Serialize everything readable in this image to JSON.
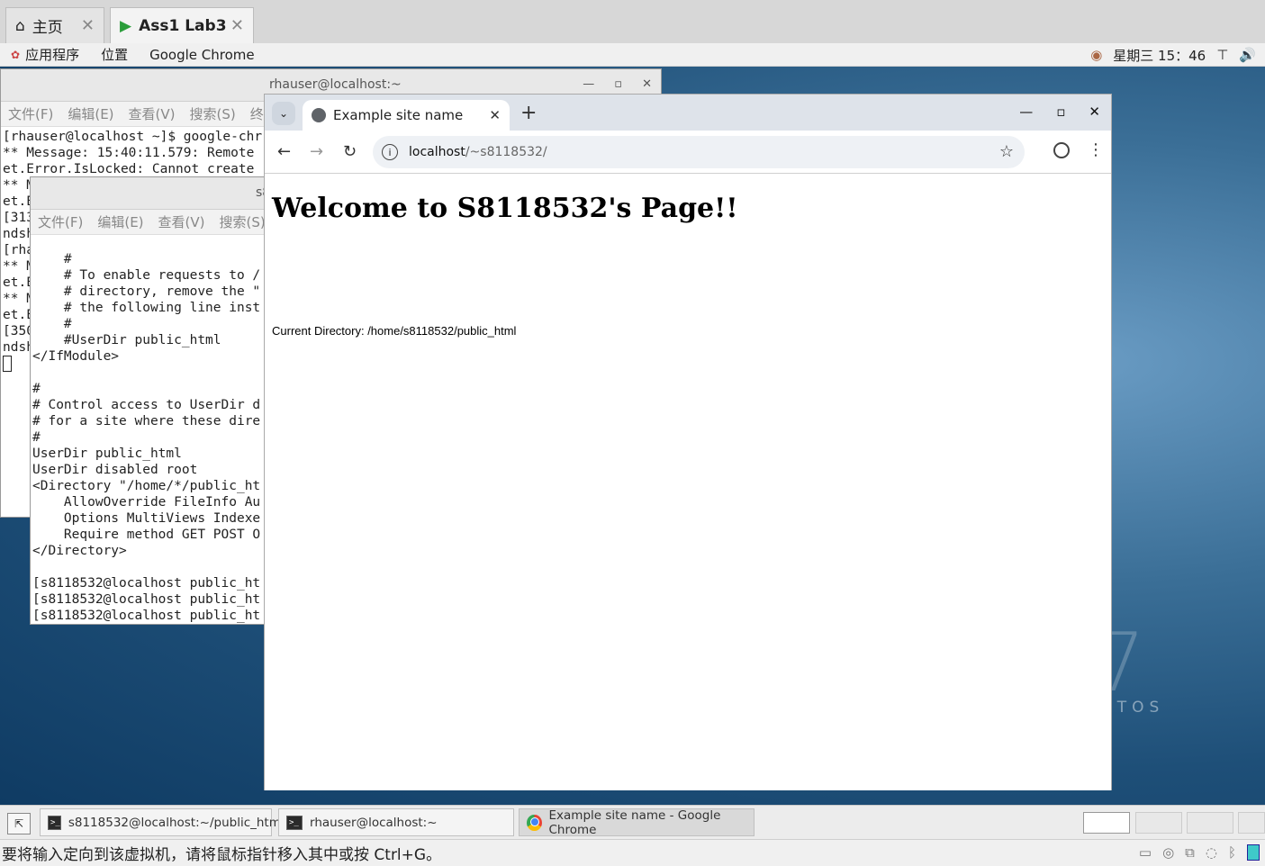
{
  "vm_tabs": [
    {
      "label": "主页",
      "icon": "home-icon"
    },
    {
      "label": "Ass1 Lab3",
      "icon": "vm-play-icon"
    }
  ],
  "gnome_bar": {
    "apps": "应用程序",
    "places": "位置",
    "active_app": "Google Chrome",
    "datetime": "星期三 15：46"
  },
  "terminal1": {
    "title": "rhauser@localhost:~",
    "menu": [
      "文件(F)",
      "编辑(E)",
      "查看(V)",
      "搜索(S)",
      "终端"
    ],
    "lines": [
      "[rhauser@localhost ~]$ google-chr",
      "** Message: 15:40:11.579: Remote",
      "et.Error.IsLocked: Cannot create",
      "** M",
      "et.E",
      "[313",
      "ndsh",
      "[rha",
      "** M",
      "et.E",
      "** M",
      "et.E",
      "[350",
      "ndsh"
    ]
  },
  "terminal2": {
    "title": "s8",
    "menu": [
      "文件(F)",
      "编辑(E)",
      "查看(V)",
      "搜索(S)"
    ],
    "lines": [
      "    #",
      "    # To enable requests to /",
      "    # directory, remove the \"",
      "    # the following line inst",
      "    #",
      "    #UserDir public_html",
      "</IfModule>",
      "",
      "#",
      "# Control access to UserDir d",
      "# for a site where these dire",
      "#",
      "UserDir public_html",
      "UserDir disabled root",
      "<Directory \"/home/*/public_ht",
      "    AllowOverride FileInfo Au",
      "    Options MultiViews Indexe",
      "    Require method GET POST O",
      "</Directory>",
      "",
      "[s8118532@localhost public_ht",
      "[s8118532@localhost public_ht",
      "[s8118532@localhost public_ht"
    ]
  },
  "chrome": {
    "tab_title": "Example site name",
    "url_host": "localhost",
    "url_path": "/~s8118532/",
    "page_heading": "Welcome to S8118532's Page!!",
    "current_dir": "Current Directory: /home/s8118532/public_html"
  },
  "taskbar": {
    "items": [
      {
        "label": "s8118532@localhost:~/public_html",
        "icon": "terminal-icon"
      },
      {
        "label": "rhauser@localhost:~",
        "icon": "terminal-icon"
      },
      {
        "label": "Example site name - Google Chrome",
        "icon": "chrome-icon"
      }
    ]
  },
  "desktop": {
    "watermark_number": "7",
    "watermark_word": "NTOS"
  },
  "status_bar": {
    "message": "要将输入定向到该虚拟机，请将鼠标指针移入其中或按 Ctrl+G。"
  }
}
